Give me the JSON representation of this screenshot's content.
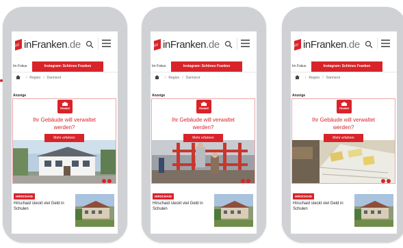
{
  "phones": [
    {
      "logo": {
        "brand": "inFranken",
        "tld": ".de"
      },
      "nav": {
        "first": "Im Fokus",
        "active": "Instagram: Schönes Franken"
      },
      "breadcrumb": [
        "Region",
        "Darmsrot"
      ],
      "ad_label": "Anzeige",
      "ad": {
        "brand": "FRANKE",
        "headline_line1": "Ihr Gebäude will verwaltet",
        "headline_line2": "werden?",
        "cta": "Mehr erfahren",
        "scene": "house"
      },
      "news": {
        "tag": "HIRSCHAID",
        "title": "Hirschaid steckt viel Geld in Schulen"
      }
    },
    {
      "logo": {
        "brand": "inFranken",
        "tld": ".de"
      },
      "nav": {
        "first": "Im Fokus",
        "active": "Instagram: Schönes Franken"
      },
      "breadcrumb": [
        "Region",
        "Darmsrot"
      ],
      "ad_label": "Anzeige",
      "ad": {
        "brand": "FRANKE",
        "headline_line1": "Ihr Gebäude will verwaltet",
        "headline_line2": "werden?",
        "cta": "Mehr erfahren",
        "scene": "workers"
      },
      "news": {
        "tag": "HIRSCHAID",
        "title": "Hirschaid steckt viel Geld in Schulen"
      }
    },
    {
      "logo": {
        "brand": "inFranken",
        "tld": ".de"
      },
      "nav": {
        "first": "Im Fokus",
        "active": "Instagram: Schönes Franken"
      },
      "breadcrumb": [
        "Region",
        "Darmsrot"
      ],
      "ad_label": "Anzeige",
      "ad": {
        "brand": "FRANKE",
        "headline_line1": "Ihr Gebäude will verwaltet",
        "headline_line2": "werden?",
        "cta": "Mehr erfahren",
        "scene": "plans"
      },
      "news": {
        "tag": "HIRSCHAID",
        "title": "Hirschaid steckt viel Geld in Schulen"
      }
    }
  ],
  "colors": {
    "accent": "#d8232a",
    "phone_frame": "#cfd1d4",
    "text": "#222222"
  },
  "icons": [
    "search-icon",
    "menu-icon",
    "home-icon",
    "logo-mark-icon"
  ]
}
